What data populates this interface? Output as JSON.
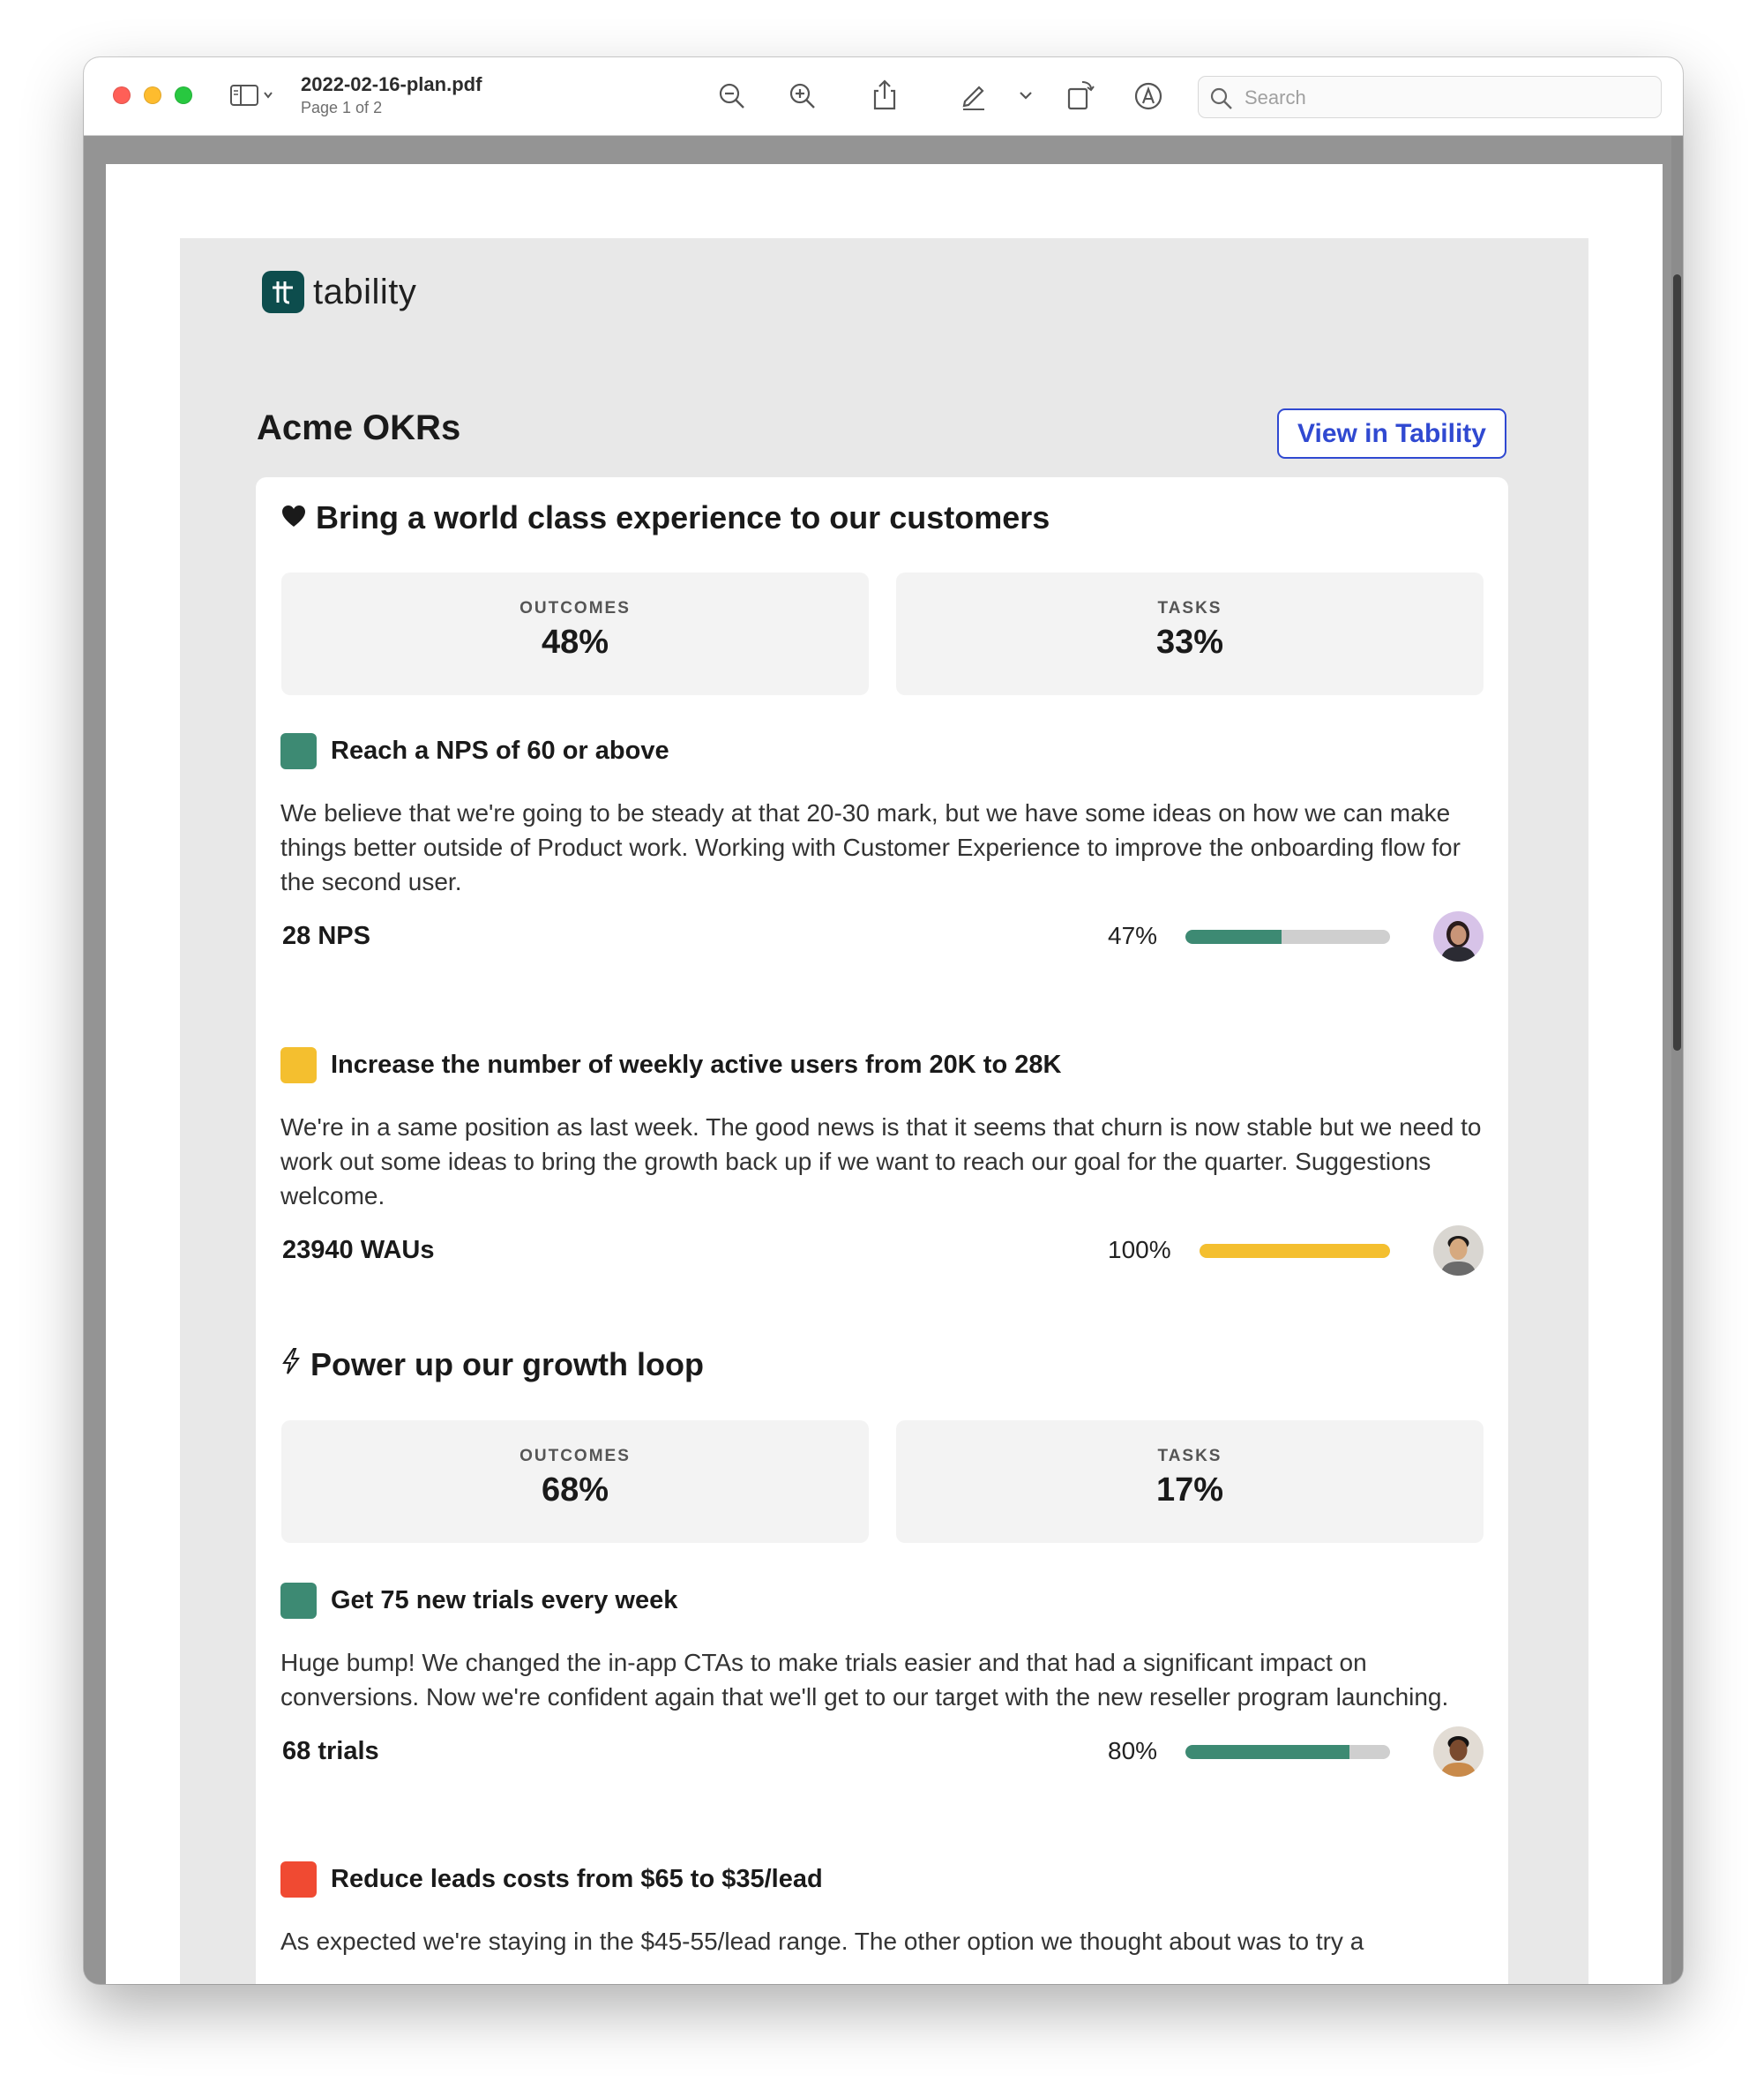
{
  "window": {
    "doc_title": "2022-02-16-plan.pdf",
    "page_info": "Page 1 of 2",
    "search_placeholder": "Search"
  },
  "email": {
    "logo_text": "tability",
    "okr_title": "Acme OKRs",
    "view_button": "View in Tability"
  },
  "objectives": [
    {
      "icon": "heart-icon",
      "icon_glyph": "❤",
      "title": "Bring a world class experience to our customers",
      "outcomes_label": "OUTCOMES",
      "outcomes_value": "48%",
      "tasks_label": "TASKS",
      "tasks_value": "33%",
      "key_results": [
        {
          "title": "Reach a NPS of 60 or above",
          "status_color": "#3d8a73",
          "description": "We believe that we're going to be steady at that 20-30 mark, but we have some ideas on how we can make things better outside of Product work. Working with Customer Experience to improve the onboarding flow for the second user.",
          "metric": "28 NPS",
          "progress_text": "47%",
          "progress": 0.47,
          "bar_color": "#3d8a73"
        },
        {
          "title": "Increase the number of weekly active users from 20K to 28K",
          "status_color": "#f4bf2f",
          "description": "We're in a same position as last week. The good news is that it seems that churn is now stable but we need to work out some ideas to bring the growth back up if we want to reach our goal for the quarter. Suggestions welcome.",
          "metric": "23940 WAUs",
          "progress_text": "100%",
          "progress": 1.0,
          "bar_color": "#f4bf2f"
        }
      ]
    },
    {
      "icon": "lightning-icon",
      "icon_glyph": "⚡",
      "title": "Power up our growth loop",
      "outcomes_label": "OUTCOMES",
      "outcomes_value": "68%",
      "tasks_label": "TASKS",
      "tasks_value": "17%",
      "key_results": [
        {
          "title": "Get 75 new trials every week",
          "status_color": "#3d8a73",
          "description": "Huge bump! We changed the in-app CTAs to make trials easier and that had a significant impact on conversions. Now we're confident again that we'll get to our target with the new reseller program launching.",
          "metric": "68 trials",
          "progress_text": "80%",
          "progress": 0.8,
          "bar_color": "#3d8a73"
        },
        {
          "title": "Reduce leads costs from $65 to $35/lead",
          "status_color": "#f04a32",
          "description": "As expected we're staying in the $45-55/lead range. The other option we thought about was to try a"
        }
      ]
    }
  ]
}
